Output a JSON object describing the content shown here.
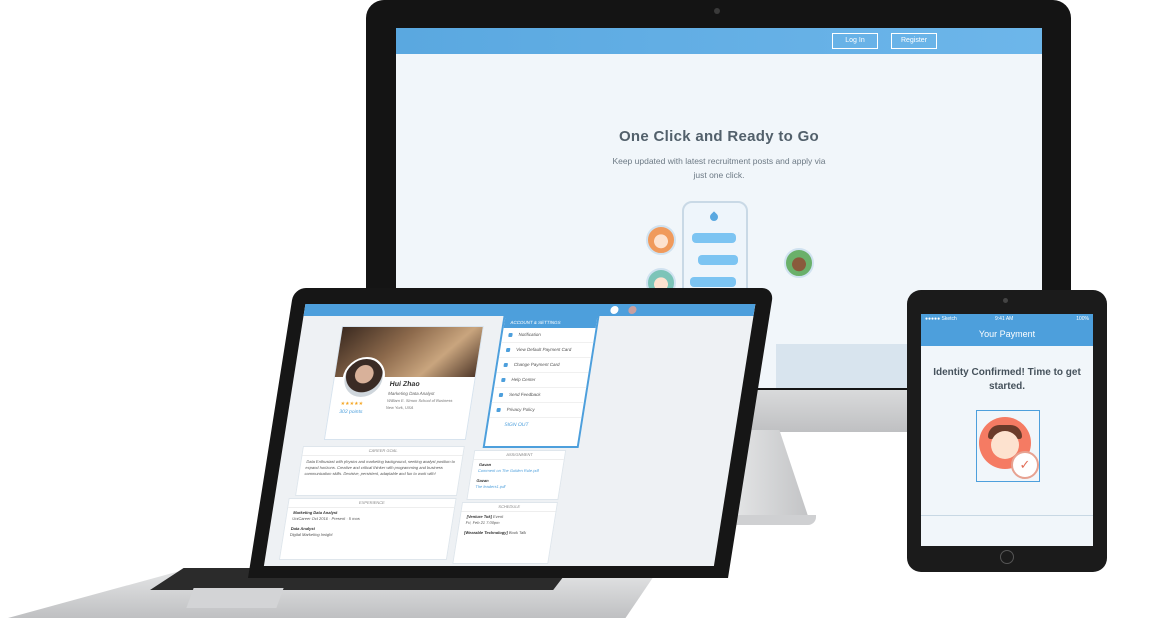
{
  "desktop": {
    "nav": {
      "login_label": "Log In",
      "register_label": "Register"
    },
    "hero": {
      "title": "One Click and Ready to Go",
      "subtitle": "Keep updated with latest recruitment posts and apply via just one click."
    }
  },
  "laptop": {
    "profile": {
      "name": "Hui Zhao",
      "role": "Marketing Data Analyst",
      "school": "William E. Simon School of Business",
      "location": "New York, USA",
      "stars": "★★★★★",
      "points": "302 points"
    },
    "settings_menu": {
      "header": "ACCOUNT & SETTINGS",
      "items": [
        {
          "label": "Notification"
        },
        {
          "label": "View Default Payment Card"
        },
        {
          "label": "Change Payment Card"
        },
        {
          "label": "Help Center"
        },
        {
          "label": "Send Feedback"
        },
        {
          "label": "Privacy Policy"
        }
      ],
      "signout": "SIGN OUT"
    },
    "career_goal": {
      "header": "CAREER GOAL",
      "text": "Data Enthusiast with physics and marketing background, seeking analyst position to expand horizons. Creative and critical thinker with programming and business communication skills. Decisive, persistent, adaptable and fun to work with!"
    },
    "experience": {
      "header": "EXPERIENCE",
      "items": [
        {
          "title": "Marketing Data Analyst",
          "company": "UniCareer",
          "meta": "Oct 2016 · Present · 5 mos"
        },
        {
          "title": "Data Analyst",
          "company": "Digital Marketing Insight",
          "meta": ""
        }
      ]
    },
    "assignment": {
      "header": "ASSIGNMENT",
      "items": [
        {
          "name": "Gavan",
          "note": "Comment on The Golden Rule.pdf"
        },
        {
          "name": "Gavan",
          "note": "The leaders1.pdf"
        }
      ]
    },
    "schedule": {
      "header": "SCHEDULE",
      "items": [
        {
          "title": "[Venture Tok]",
          "sub": "Event",
          "date": "Fri, Feb 21",
          "time": "7:00pm"
        },
        {
          "title": "[Wearable Technology]",
          "sub": "Book Talk",
          "date": "",
          "time": ""
        }
      ]
    }
  },
  "tablet": {
    "status": {
      "carrier": "●●●●● Sketch",
      "time": "9:41 AM",
      "battery": "100%"
    },
    "nav_title": "Your Payment",
    "message": "Identity Confirmed! Time to get started."
  },
  "colors": {
    "accent": "#4d9fdc",
    "text_dark": "#46525c",
    "confirm": "#e26e58"
  },
  "icons": [
    "apple-logo-icon",
    "drop-logo-icon",
    "check-icon",
    "pencil-icon",
    "star-icon"
  ]
}
